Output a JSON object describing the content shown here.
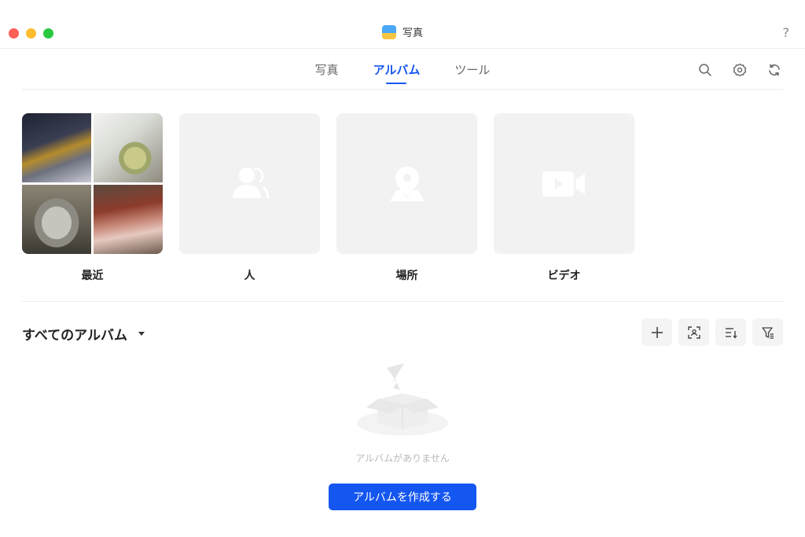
{
  "window": {
    "title": "写真",
    "help_label": "?"
  },
  "tabs": [
    {
      "label": "写真",
      "active": false
    },
    {
      "label": "アルバム",
      "active": true
    },
    {
      "label": "ツール",
      "active": false
    }
  ],
  "nav_icons": [
    "search-icon",
    "settings-icon",
    "sync-icon"
  ],
  "cards": [
    {
      "label": "最近",
      "type": "mosaic"
    },
    {
      "label": "人",
      "icon": "person-icon"
    },
    {
      "label": "場所",
      "icon": "location-pin-icon"
    },
    {
      "label": "ビデオ",
      "icon": "video-icon"
    }
  ],
  "albums_section": {
    "title": "すべてのアルバム",
    "tools": [
      "add-icon",
      "face-scan-icon",
      "sort-icon",
      "filter-icon"
    ]
  },
  "empty_state": {
    "message": "アルバムがありません",
    "create_button": "アルバムを作成する"
  },
  "colors": {
    "accent": "#1456f0",
    "card_bg": "#f2f2f2",
    "icon_placeholder": "#ffffff"
  }
}
